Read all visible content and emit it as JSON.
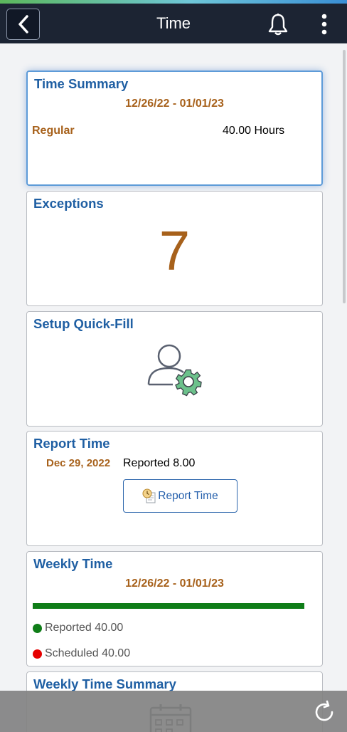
{
  "header": {
    "title": "Time",
    "back_icon": "chevron-left-icon",
    "notification_icon": "bell-icon",
    "actions_icon": "kebab-menu-icon"
  },
  "tiles": {
    "time_summary": {
      "title": "Time Summary",
      "date_range": "12/26/22 - 01/01/23",
      "category": "Regular",
      "hours": "40.00 Hours"
    },
    "exceptions": {
      "title": "Exceptions",
      "count": "7"
    },
    "setup_quick_fill": {
      "title": "Setup Quick-Fill",
      "icon": "user-settings-icon"
    },
    "report_time": {
      "title": "Report Time",
      "date": "Dec 29, 2022",
      "reported": "Reported 8.00",
      "button_label": "Report Time"
    },
    "weekly_time": {
      "title": "Weekly Time",
      "date_range": "12/26/22 - 01/01/23",
      "progress": 1.0,
      "reported": "Reported 40.00",
      "scheduled": "Scheduled 40.00",
      "reported_color": "#0f7d18",
      "scheduled_color": "#e60000"
    },
    "weekly_time_summary": {
      "title": "Weekly Time Summary",
      "icon": "calendar-icon"
    }
  },
  "footer": {
    "refresh_icon": "refresh-icon"
  },
  "colors": {
    "header_bg": "#1c2433",
    "tile_title": "#1f5fa3",
    "accent_orange": "#a7611b",
    "progress_green": "#0f7d18"
  }
}
